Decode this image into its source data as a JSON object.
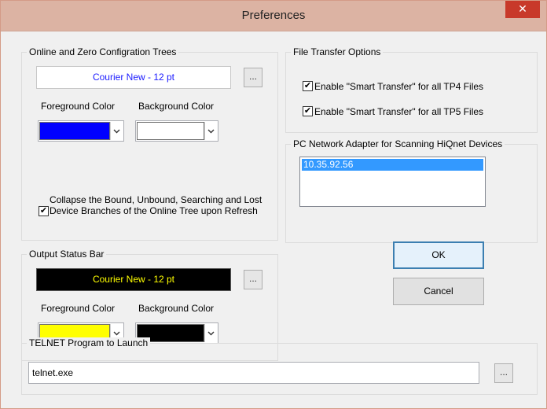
{
  "window": {
    "title": "Preferences",
    "close_glyph": "✕"
  },
  "online_trees": {
    "group_title": "Online and Zero Configration Trees",
    "font_label": "Courier New - 12 pt",
    "ellipsis": "...",
    "fg_label": "Foreground Color",
    "bg_label": "Background Color",
    "fg_color": "#0000ff",
    "bg_color": "#ffffff",
    "collapse_checked": true,
    "collapse_label": "Collapse the Bound, Unbound, Searching and Lost Device Branches of the Online Tree upon Refresh"
  },
  "output_status": {
    "group_title": "Output Status Bar",
    "font_label": "Courier New - 12 pt",
    "ellipsis": "...",
    "fg_label": "Foreground Color",
    "bg_label": "Background Color",
    "fg_color": "#ffff00",
    "bg_color": "#000000"
  },
  "file_transfer": {
    "group_title": "File Transfer Options",
    "tp4_label": "Enable \"Smart Transfer\" for all TP4 Files",
    "tp4_checked": true,
    "tp5_label": "Enable \"Smart Transfer\" for all TP5 Files",
    "tp5_checked": true
  },
  "network_adapter": {
    "group_title": "PC Network Adapter for Scanning HiQnet Devices",
    "items": [
      "10.35.92.56"
    ],
    "selected_index": 0
  },
  "buttons": {
    "ok": "OK",
    "cancel": "Cancel"
  },
  "telnet": {
    "group_title": "TELNET Program to Launch",
    "value": "telnet.exe",
    "ellipsis": "..."
  },
  "icons": {
    "check": "✔",
    "chevron": "chevron-down-icon",
    "close": "close-icon"
  }
}
